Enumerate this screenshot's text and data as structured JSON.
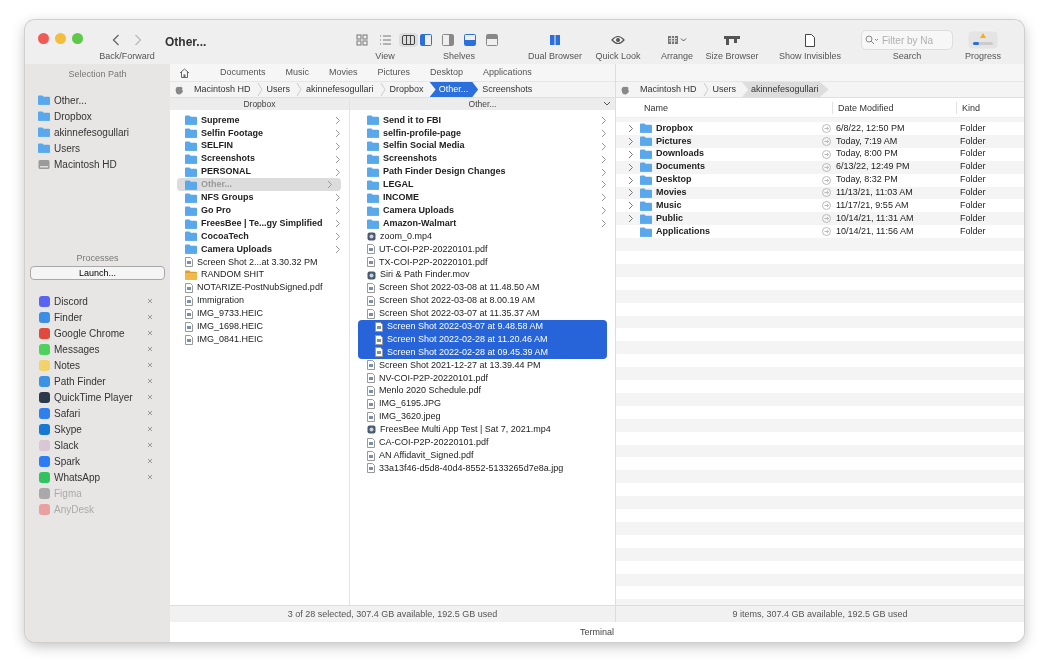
{
  "window": {
    "title": "Other..."
  },
  "toolbar": {
    "nav_label": "Back/Forward",
    "groups": [
      {
        "kind": "view",
        "label": "View",
        "buttons": [
          {
            "selected": false
          },
          {
            "selected": false
          },
          {
            "selected": true
          }
        ]
      },
      {
        "kind": "shelves",
        "label": "Shelves",
        "buttons": [
          {
            "on": true
          },
          {
            "on": false
          },
          {
            "on": true
          },
          {
            "on": false
          }
        ]
      },
      {
        "kind": "dual_browser",
        "label": "Dual Browser",
        "on": true
      },
      {
        "kind": "quick_look",
        "label": "Quick Look"
      },
      {
        "kind": "arrange",
        "label": "Arrange"
      },
      {
        "kind": "size_browser",
        "label": "Size Browser"
      },
      {
        "kind": "show_invisibles",
        "label": "Show Invisibles"
      },
      {
        "kind": "search",
        "label": "Search",
        "placeholder": "Filter by Na"
      },
      {
        "kind": "progress",
        "label": "Progress"
      }
    ]
  },
  "sidebar": {
    "selection_path": {
      "title": "Selection Path",
      "items": [
        {
          "label": "Other...",
          "kind": "folder"
        },
        {
          "label": "Dropbox",
          "kind": "folder"
        },
        {
          "label": "akinnefesogullari",
          "kind": "folder"
        },
        {
          "label": "Users",
          "kind": "folder"
        },
        {
          "label": "Macintosh HD",
          "kind": "disk"
        }
      ]
    },
    "processes": {
      "title": "Processes",
      "launch_button": "Launch...",
      "apps": [
        {
          "name": "Discord",
          "running": true,
          "color": "#5865f2"
        },
        {
          "name": "Finder",
          "running": true,
          "color": "#3d8ee6"
        },
        {
          "name": "Google Chrome",
          "running": true,
          "color": "#e0493b"
        },
        {
          "name": "Messages",
          "running": true,
          "color": "#4fd15e"
        },
        {
          "name": "Notes",
          "running": true,
          "color": "#f2d36b"
        },
        {
          "name": "Path Finder",
          "running": true,
          "color": "#3a92e4"
        },
        {
          "name": "QuickTime Player",
          "running": true,
          "color": "#2c3a4c"
        },
        {
          "name": "Safari",
          "running": true,
          "color": "#2f80ee"
        },
        {
          "name": "Skype",
          "running": true,
          "color": "#1478d4"
        },
        {
          "name": "Slack",
          "running": true,
          "color": "#d9c7d6"
        },
        {
          "name": "Spark",
          "running": true,
          "color": "#2d7cf6"
        },
        {
          "name": "WhatsApp",
          "running": true,
          "color": "#2fc45f"
        },
        {
          "name": "Figma",
          "running": false,
          "color": "#a9a9a9"
        },
        {
          "name": "AnyDesk",
          "running": false,
          "color": "#e9a0a0"
        }
      ]
    }
  },
  "left_pane": {
    "focused": true,
    "favorites": [
      "Documents",
      "Music",
      "Movies",
      "Pictures",
      "Desktop",
      "Applications"
    ],
    "path": [
      {
        "label": "Macintosh HD",
        "selected": false
      },
      {
        "label": "Users",
        "selected": false
      },
      {
        "label": "akinnefesogullari",
        "selected": false
      },
      {
        "label": "Dropbox",
        "selected": false
      },
      {
        "label": "Other...",
        "selected": true
      },
      {
        "label": "Screenshots",
        "selected": false
      }
    ],
    "columns": [
      {
        "header": "Dropbox",
        "active": false,
        "items": [
          {
            "name": "Supreme",
            "kind": "folder",
            "selected": false
          },
          {
            "name": "Selfin Footage",
            "kind": "folder",
            "selected": false
          },
          {
            "name": "SELFIN",
            "kind": "folder",
            "selected": false
          },
          {
            "name": "Screenshots",
            "kind": "folder",
            "selected": false
          },
          {
            "name": "PERSONAL",
            "kind": "folder",
            "selected": false
          },
          {
            "name": "Other...",
            "kind": "folder",
            "selected": true
          },
          {
            "name": "NFS Groups",
            "kind": "folder",
            "selected": false
          },
          {
            "name": "Go Pro",
            "kind": "folder",
            "selected": false
          },
          {
            "name": "FreesBee | Te...gy Simplified",
            "kind": "folder",
            "selected": false
          },
          {
            "name": "CocoaTech",
            "kind": "folder",
            "selected": false
          },
          {
            "name": "Camera Uploads",
            "kind": "folder",
            "selected": false
          },
          {
            "name": "Screen Shot 2...at 3.30.32 PM",
            "kind": "file",
            "selected": false
          },
          {
            "name": "RANDOM SHIT",
            "kind": "package",
            "selected": false
          },
          {
            "name": "NOTARIZE-PostNubSigned.pdf",
            "kind": "file",
            "selected": false
          },
          {
            "name": "Immigration",
            "kind": "file",
            "selected": false
          },
          {
            "name": "IMG_9733.HEIC",
            "kind": "file",
            "selected": false
          },
          {
            "name": "IMG_1698.HEIC",
            "kind": "file",
            "selected": false
          },
          {
            "name": "IMG_0841.HEIC",
            "kind": "file",
            "selected": false
          }
        ]
      },
      {
        "header": "Other...",
        "active": true,
        "items": [
          {
            "name": "Send it to FBI",
            "kind": "folder",
            "selected": false
          },
          {
            "name": "selfin-profile-page",
            "kind": "folder",
            "selected": false
          },
          {
            "name": "Selfin Social Media",
            "kind": "folder",
            "selected": false
          },
          {
            "name": "Screenshots",
            "kind": "folder",
            "selected": false
          },
          {
            "name": "Path Finder Design Changes",
            "kind": "folder",
            "selected": false
          },
          {
            "name": "LEGAL",
            "kind": "folder",
            "selected": false
          },
          {
            "name": "INCOME",
            "kind": "folder",
            "selected": false
          },
          {
            "name": "Camera Uploads",
            "kind": "folder",
            "selected": false
          },
          {
            "name": "Amazon-Walmart",
            "kind": "folder",
            "selected": false
          },
          {
            "name": "zoom_0.mp4",
            "kind": "video",
            "selected": false
          },
          {
            "name": "UT-COI-P2P-20220101.pdf",
            "kind": "file",
            "selected": false
          },
          {
            "name": "TX-COI-P2P-20220101.pdf",
            "kind": "file",
            "selected": false
          },
          {
            "name": "Siri & Path Finder.mov",
            "kind": "video",
            "selected": false
          },
          {
            "name": "Screen Shot 2022-03-08 at 11.48.50 AM",
            "kind": "file",
            "selected": false
          },
          {
            "name": "Screen Shot 2022-03-08 at 8.00.19 AM",
            "kind": "file",
            "selected": false
          },
          {
            "name": "Screen Shot 2022-03-07 at 11.35.37 AM",
            "kind": "file",
            "selected": false
          },
          {
            "name": "Screen Shot 2022-03-07 at 9.48.58 AM",
            "kind": "file",
            "selected": true
          },
          {
            "name": "Screen Shot 2022-02-28 at 11.20.46 AM",
            "kind": "file",
            "selected": true
          },
          {
            "name": "Screen Shot 2022-02-28 at 09.45.39 AM",
            "kind": "file",
            "selected": true
          },
          {
            "name": "Screen Shot 2021-12-27 at 13.39.44 PM",
            "kind": "file",
            "selected": false
          },
          {
            "name": "NV-COI-P2P-20220101.pdf",
            "kind": "file",
            "selected": false
          },
          {
            "name": "Menlo 2020 Schedule.pdf",
            "kind": "file",
            "selected": false
          },
          {
            "name": "IMG_6195.JPG",
            "kind": "file",
            "selected": false
          },
          {
            "name": "IMG_3620.jpeg",
            "kind": "file",
            "selected": false
          },
          {
            "name": "FreesBee Multi App Test | Sat 7, 2021.mp4",
            "kind": "video",
            "selected": false
          },
          {
            "name": "CA-COI-P2P-20220101.pdf",
            "kind": "file",
            "selected": false
          },
          {
            "name": "AN Affidavit_Signed.pdf",
            "kind": "file",
            "selected": false
          },
          {
            "name": "33a13f46-d5d8-40d4-8552-5133265d7e8a.jpg",
            "kind": "file",
            "selected": false
          }
        ]
      }
    ],
    "status": "3 of 28 selected, 307.4 GB available, 192.5 GB used"
  },
  "right_pane": {
    "focused": false,
    "path": [
      {
        "label": "Macintosh HD",
        "selected": false
      },
      {
        "label": "Users",
        "selected": false
      },
      {
        "label": "akinnefesogullari",
        "selected": true
      }
    ],
    "table": {
      "columns": [
        "Name",
        "Date Modified",
        "Kind"
      ],
      "rows": [
        {
          "name": "Dropbox",
          "date": "6/8/22, 12:50 PM",
          "kind": "Folder",
          "expandable": true
        },
        {
          "name": "Pictures",
          "date": "Today, 7:19 AM",
          "kind": "Folder",
          "expandable": true
        },
        {
          "name": "Downloads",
          "date": "Today, 8:00 PM",
          "kind": "Folder",
          "expandable": true
        },
        {
          "name": "Documents",
          "date": "6/13/22, 12:49 PM",
          "kind": "Folder",
          "expandable": true
        },
        {
          "name": "Desktop",
          "date": "Today, 8:32 PM",
          "kind": "Folder",
          "expandable": true
        },
        {
          "name": "Movies",
          "date": "11/13/21, 11:03 AM",
          "kind": "Folder",
          "expandable": true
        },
        {
          "name": "Music",
          "date": "11/17/21, 9:55 AM",
          "kind": "Folder",
          "expandable": true
        },
        {
          "name": "Public",
          "date": "10/14/21, 11:31 AM",
          "kind": "Folder",
          "expandable": true
        },
        {
          "name": "Applications",
          "date": "10/14/21, 11:56 AM",
          "kind": "Folder",
          "expandable": false
        }
      ]
    },
    "status": "9 items, 307.4 GB available, 192.5 GB used"
  },
  "bottom_bar": {
    "label": "Terminal"
  }
}
